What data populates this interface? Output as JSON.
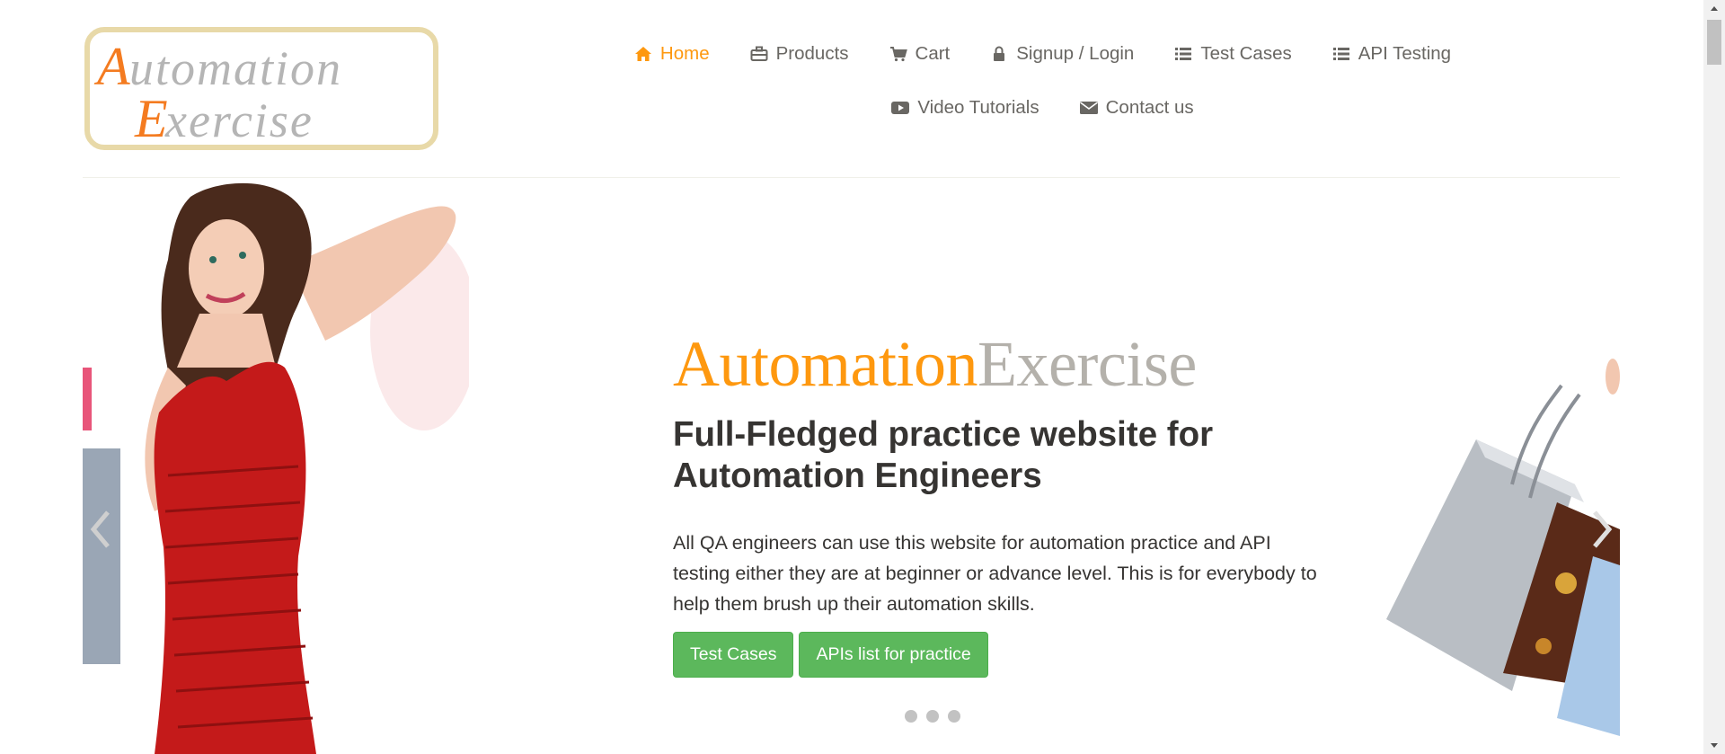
{
  "logo": {
    "alt": "Automation Exercise",
    "line1": "Automation",
    "line2": "Exercise"
  },
  "nav": {
    "items": [
      {
        "label": "Home",
        "icon": "home-icon"
      },
      {
        "label": "Products",
        "icon": "briefcase-icon"
      },
      {
        "label": "Cart",
        "icon": "cart-icon"
      },
      {
        "label": "Signup / Login",
        "icon": "lock-icon"
      },
      {
        "label": "Test Cases",
        "icon": "list-icon"
      },
      {
        "label": "API Testing",
        "icon": "list-icon"
      },
      {
        "label": "Video Tutorials",
        "icon": "youtube-play-icon"
      },
      {
        "label": "Contact us",
        "icon": "envelope-icon"
      }
    ],
    "active": "Home"
  },
  "slider": {
    "brand_part1": "Automation",
    "brand_part2": "Exercise",
    "headline": "Full-Fledged practice website for Automation Engineers",
    "description": "All QA engineers can use this website for automation practice and API testing either they are at beginner or advance level. This is for everybody to help them brush up their automation skills.",
    "buttons": {
      "test_cases": "Test Cases",
      "apis_list": "APIs list for practice"
    },
    "dot_count": 3
  },
  "colors": {
    "accent": "#fe980f",
    "brand_grey": "#b4b1ab",
    "button_green": "#5cb85c",
    "text_dark": "#363432",
    "nav_text": "#696763"
  }
}
